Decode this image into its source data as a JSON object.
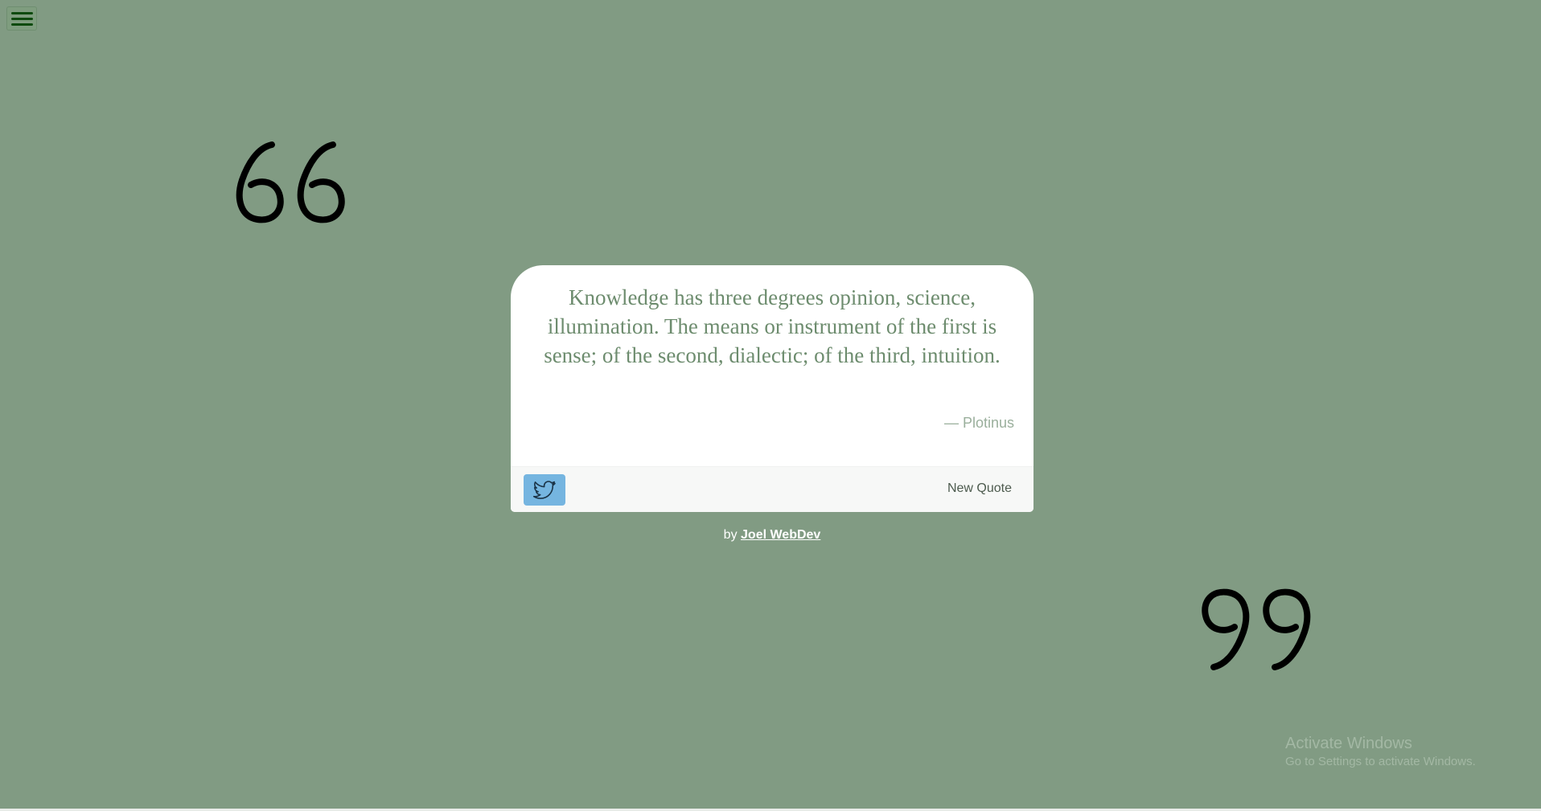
{
  "menu": {
    "icon": "hamburger-icon"
  },
  "quote": {
    "text": "Knowledge has three degrees opinion, science, illumination. The means or instrument of the first is sense; of the second, dialectic; of the third, intuition.",
    "author": "— Plotinus"
  },
  "actions": {
    "tweet_icon": "twitter-icon",
    "new_quote_label": "New Quote"
  },
  "footer": {
    "by_label": "by",
    "author_link": "Joel WebDev"
  },
  "windows_notice": {
    "title": "Activate Windows",
    "subtitle": "Go to Settings to activate Windows."
  },
  "colors": {
    "background": "#819b83",
    "quote_text": "#6d8c6e",
    "tweet_button": "#75b5e0",
    "menu_icon": "#0e4a0e"
  }
}
